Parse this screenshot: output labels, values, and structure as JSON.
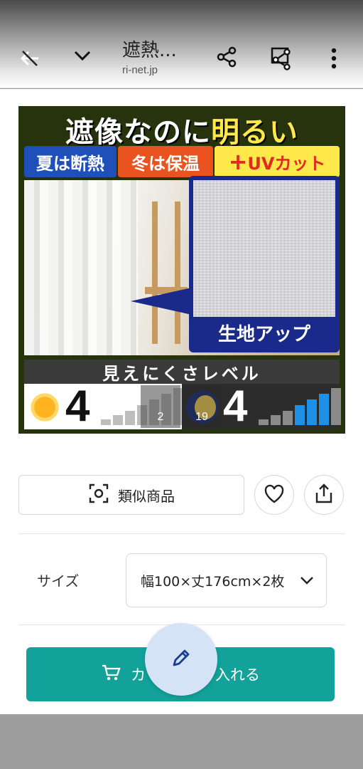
{
  "topbar": {
    "title": "遮熱...",
    "subtitle": "ri-net.jp",
    "icons": [
      "back-arrow-icon",
      "chevron-down-icon",
      "share-icon",
      "share-screenshot-icon",
      "more-vert-icon"
    ]
  },
  "product_image": {
    "headline_white": "遮像なのに",
    "headline_yellow": "明るい",
    "band_1": "夏は断熱",
    "band_2": "冬は保温",
    "band_3_plus": "+",
    "band_3_main": "UVカット",
    "fabric_label": "生地アップ",
    "level_title": "見えにくさレベル",
    "day_level": "4",
    "night_level": "4",
    "image_counter_1": "2",
    "image_counter_2": "19"
  },
  "actions": {
    "similar_label": "類似商品",
    "favorite_icon": "heart-icon",
    "share_icon": "share-upload-icon"
  },
  "size": {
    "label": "サイズ",
    "selected": "幅100×丈176cm×2枚"
  },
  "cart": {
    "label_left": "カ",
    "label_right": "入れる"
  },
  "colors": {
    "accent": "#12a299",
    "fab": "#d6e3f7"
  }
}
